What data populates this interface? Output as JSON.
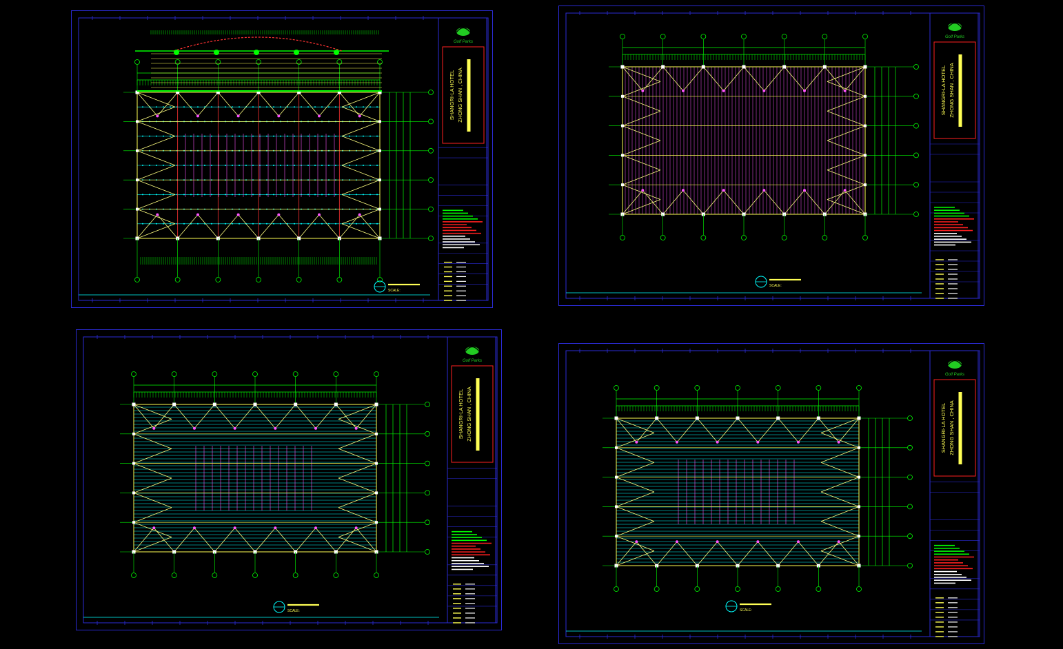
{
  "colors": {
    "background": "#000000",
    "frame": "#2b2bd6",
    "grid_line": "#ffff55",
    "bracing": "#ffff80",
    "purlin": "#00ffff",
    "secondary": "#ff55ff",
    "dimension": "#00ff00",
    "column": "#ff3333",
    "title_box": "#ff2020",
    "logo": "#22cc22"
  },
  "titleblock": {
    "logo_text": "Golf Parks",
    "hotel_line1": "SHANGRI-LA HOTEL",
    "hotel_line2": "ZHONG SHAN , CHINA"
  },
  "sheets": [
    {
      "id": "sheet-1",
      "caption": "",
      "scale": "SCALE:",
      "variant": "roof-elevation"
    },
    {
      "id": "sheet-2",
      "caption": "",
      "scale": "SCALE:",
      "variant": "dense-purlin"
    },
    {
      "id": "sheet-3",
      "caption": "",
      "scale": "SCALE:",
      "variant": "horizontal-purlin"
    },
    {
      "id": "sheet-4",
      "caption": "",
      "scale": "SCALE:",
      "variant": "horizontal-purlin"
    }
  ],
  "icons": {
    "logo": "palm-logo-icon",
    "section_marker": "circle-marker-icon"
  }
}
